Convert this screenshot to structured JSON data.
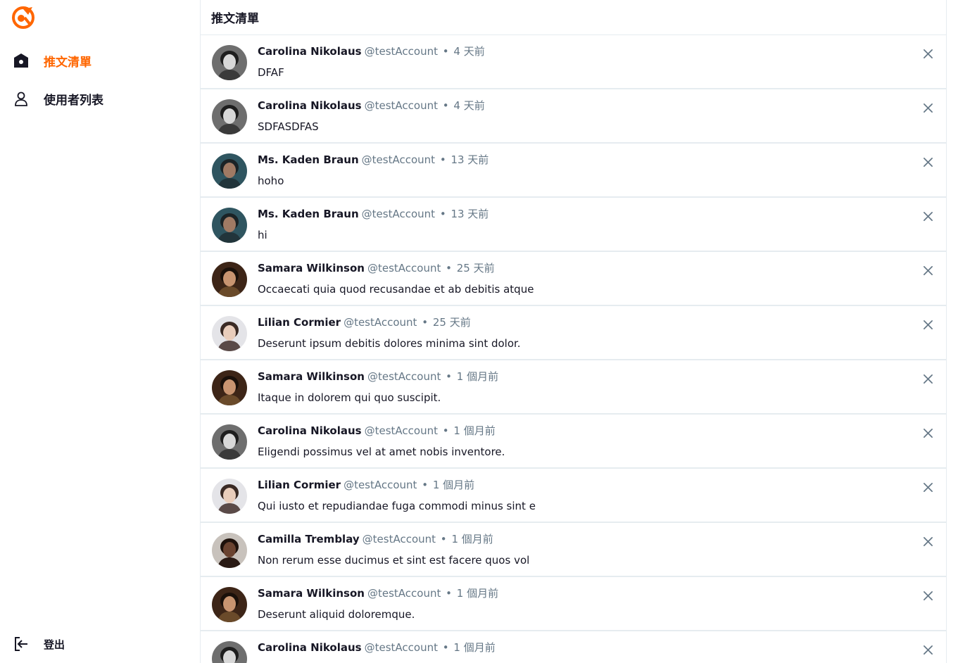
{
  "sidebar": {
    "logo_icon": "alphitter-logo-icon",
    "brand_color": "#ff6600",
    "items": [
      {
        "label": "推文清單",
        "icon": "home-icon",
        "active": true
      },
      {
        "label": "使用者列表",
        "icon": "user-icon",
        "active": false
      }
    ],
    "logout": {
      "label": "登出",
      "icon": "logout-icon"
    }
  },
  "header": {
    "title": "推文清單"
  },
  "tweets": [
    {
      "name": "Carolina Nikolaus",
      "account": "@testAccount",
      "dot": "•",
      "time": "4 天前",
      "text": "DFAF",
      "avatar": "mono"
    },
    {
      "name": "Carolina Nikolaus",
      "account": "@testAccount",
      "dot": "•",
      "time": "4 天前",
      "text": "SDFASDFAS",
      "avatar": "mono"
    },
    {
      "name": "Ms. Kaden Braun",
      "account": "@testAccount",
      "dot": "•",
      "time": "13 天前",
      "text": "hoho",
      "avatar": "teal"
    },
    {
      "name": "Ms. Kaden Braun",
      "account": "@testAccount",
      "dot": "•",
      "time": "13 天前",
      "text": "hi",
      "avatar": "teal"
    },
    {
      "name": "Samara Wilkinson",
      "account": "@testAccount",
      "dot": "•",
      "time": "25 天前",
      "text": "Occaecati quia quod recusandae et ab debitis atque",
      "avatar": "brown"
    },
    {
      "name": "Lilian Cormier",
      "account": "@testAccount",
      "dot": "•",
      "time": "25 天前",
      "text": "Deserunt ipsum debitis dolores minima sint dolor.",
      "avatar": "light"
    },
    {
      "name": "Samara Wilkinson",
      "account": "@testAccount",
      "dot": "•",
      "time": "1 個月前",
      "text": "Itaque in dolorem qui quo suscipit.",
      "avatar": "brown"
    },
    {
      "name": "Carolina Nikolaus",
      "account": "@testAccount",
      "dot": "•",
      "time": "1 個月前",
      "text": "Eligendi possimus vel at amet nobis inventore.",
      "avatar": "mono"
    },
    {
      "name": "Lilian Cormier",
      "account": "@testAccount",
      "dot": "•",
      "time": "1 個月前",
      "text": "Qui iusto et repudiandae fuga commodi minus sint e",
      "avatar": "light"
    },
    {
      "name": "Camilla Tremblay",
      "account": "@testAccount",
      "dot": "•",
      "time": "1 個月前",
      "text": "Non rerum esse ducimus et sint est facere quos vol",
      "avatar": "dark"
    },
    {
      "name": "Samara Wilkinson",
      "account": "@testAccount",
      "dot": "•",
      "time": "1 個月前",
      "text": "Deserunt aliquid doloremque.",
      "avatar": "brown"
    },
    {
      "name": "Carolina Nikolaus",
      "account": "@testAccount",
      "dot": "•",
      "time": "1 個月前",
      "text": "",
      "avatar": "mono"
    }
  ],
  "delete_icon": "close-icon"
}
